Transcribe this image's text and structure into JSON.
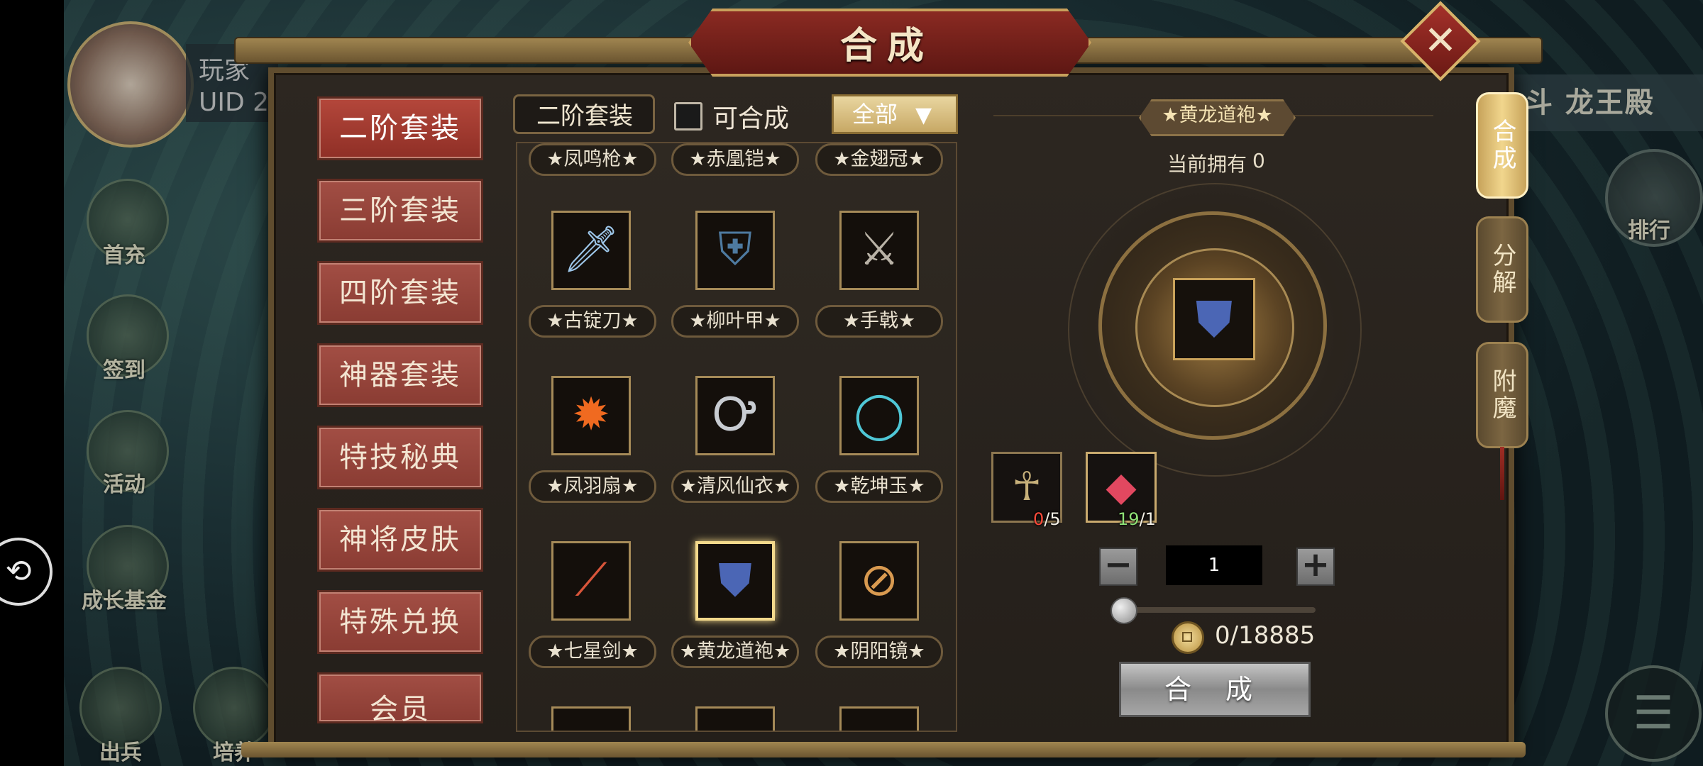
{
  "title": "合成",
  "close_icon": "close-x-icon",
  "background": {
    "player_name_partial": "玩家",
    "player_uid_partial": "UID  2",
    "right_title": "斗 龙王殿",
    "hud_buttons": [
      "首充",
      "签到",
      "活动",
      "成长基金",
      "出兵",
      "培养"
    ],
    "rank_label": "排行"
  },
  "categories": [
    "二阶套装",
    "三阶套装",
    "四阶套装",
    "神器套装",
    "特技秘典",
    "神将皮肤",
    "特殊兑换",
    "会员"
  ],
  "filter": {
    "label": "二阶套装",
    "checkbox_label": "可合成",
    "checkbox_checked": false,
    "dropdown_value": "全部"
  },
  "grid": {
    "partial_top_row": [
      "★凤鸣枪★",
      "★赤凰铠★",
      "★金翅冠★"
    ],
    "rows": [
      [
        {
          "name": "★古锭刀★",
          "icon": "sword-icon"
        },
        {
          "name": "★柳叶甲★",
          "icon": "armor-icon"
        },
        {
          "name": "★手戟★",
          "icon": "halberd-icon"
        }
      ],
      [
        {
          "name": "★凤羽扇★",
          "icon": "fire-fan-icon"
        },
        {
          "name": "★清风仙衣★",
          "icon": "robe-icon"
        },
        {
          "name": "★乾坤玉★",
          "icon": "jade-ring-icon"
        }
      ],
      [
        {
          "name": "★七星剑★",
          "icon": "spear-icon"
        },
        {
          "name": "★黄龙道袍★",
          "icon": "dragon-robe-icon",
          "selected": true
        },
        {
          "name": "★阴阳镜★",
          "icon": "mirror-icon"
        }
      ]
    ]
  },
  "detail": {
    "name": "★黄龙道袍★",
    "owned_label": "当前拥有",
    "owned_value": "0",
    "materials": [
      {
        "icon": "monster-icon",
        "have": "0",
        "need": "/5",
        "status": "insufficient"
      },
      {
        "icon": "red-gem-icon",
        "have": "19",
        "need": "/1",
        "status": "sufficient"
      }
    ],
    "quantity": "1",
    "slider_fraction": 0,
    "coin_text": "0/18885",
    "synth_button": "合 成"
  },
  "side_tabs": [
    {
      "label": "合成",
      "active": true
    },
    {
      "label": "分解",
      "active": false
    },
    {
      "label": "附魔",
      "active": false
    }
  ]
}
